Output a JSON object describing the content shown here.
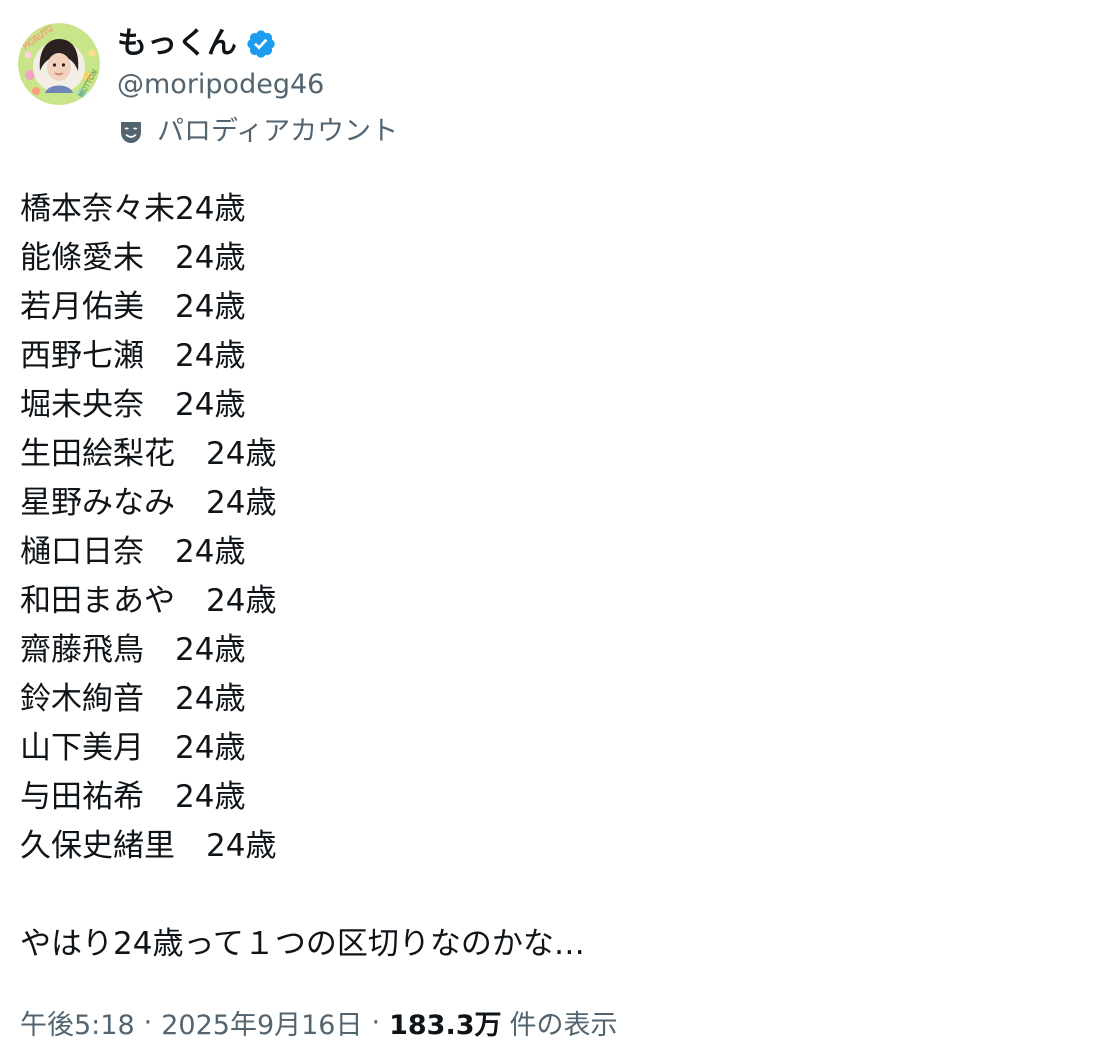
{
  "author": {
    "display_name": "もっくん",
    "handle": "@moripodeg46",
    "label": "パロディアカウント",
    "verified": true,
    "verified_badge_color": "#1d9bf0",
    "label_icon": "mask-icon",
    "avatar_caption_top": "HORUTO",
    "avatar_caption_bottom": "MOTTON"
  },
  "tweet": {
    "lines": [
      "橋本奈々未24歳",
      "能條愛未　24歳",
      "若月佑美　24歳",
      "西野七瀬　24歳",
      "堀未央奈　24歳",
      "生田絵梨花　24歳",
      "星野みなみ　24歳",
      "樋口日奈　24歳",
      "和田まあや　24歳",
      "齋藤飛鳥　24歳",
      "鈴木絢音　24歳",
      "山下美月　24歳",
      "与田祐希　24歳",
      "久保史緒里　24歳"
    ],
    "closing": "やはり24歳って１つの区切りなのかな…"
  },
  "meta": {
    "time": "午後5:18",
    "separator": "·",
    "date": "2025年9月16日",
    "views_count": "183.3万",
    "views_label": "件の表示"
  }
}
